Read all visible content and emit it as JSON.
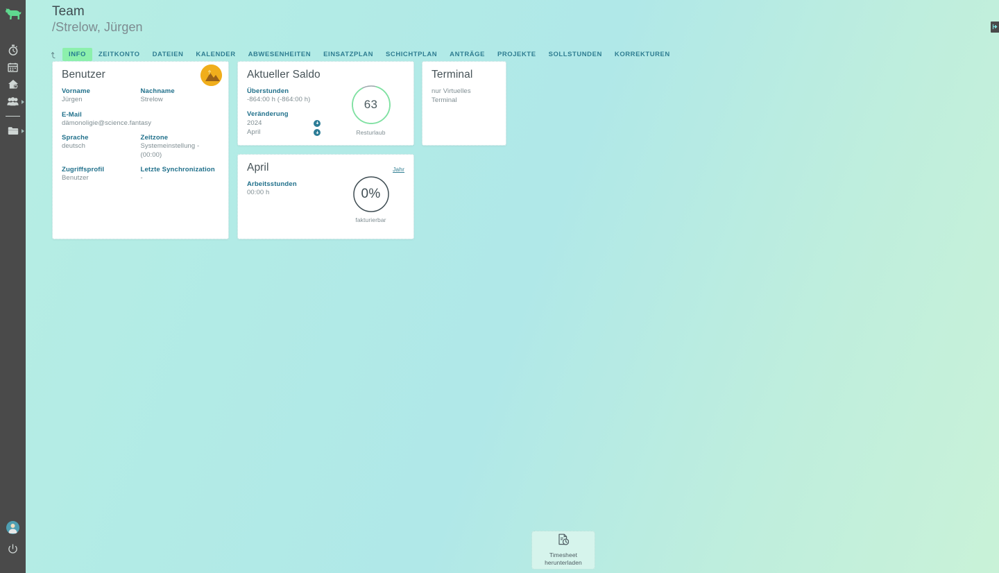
{
  "app": {
    "logo_icon": "dog-logo-icon",
    "accent_green": "#8cf0ac",
    "accent_teal": "#2e7d91",
    "sidebar_bg": "#4a4a4a"
  },
  "sidebar": {
    "items": [
      {
        "name": "stopwatch-icon",
        "label": "Zeiterfassung",
        "has_arrow": false
      },
      {
        "name": "calendar-icon",
        "label": "Kalender",
        "has_arrow": false
      },
      {
        "name": "home-clock-icon",
        "label": "Home",
        "has_arrow": false
      },
      {
        "name": "people-icon",
        "label": "Team",
        "has_arrow": true
      },
      {
        "name": "folder-icon",
        "label": "Projekte",
        "has_arrow": true
      }
    ],
    "bottom": [
      {
        "name": "user-avatar-icon",
        "label": "Benutzerkonto"
      },
      {
        "name": "power-icon",
        "label": "Abmelden"
      }
    ]
  },
  "header": {
    "title": "Team",
    "subtitle": "/Strelow, Jürgen"
  },
  "tabs": {
    "prefix_icon": "history-back-icon",
    "items": [
      {
        "label": "INFO",
        "active": true
      },
      {
        "label": "ZEITKONTO",
        "active": false
      },
      {
        "label": "DATEIEN",
        "active": false
      },
      {
        "label": "KALENDER",
        "active": false
      },
      {
        "label": "ABWESENHEITEN",
        "active": false
      },
      {
        "label": "EINSATZPLAN",
        "active": false
      },
      {
        "label": "SCHICHTPLAN",
        "active": false
      },
      {
        "label": "ANTRÄGE",
        "active": false
      },
      {
        "label": "PROJEKTE",
        "active": false
      },
      {
        "label": "SOLLSTUNDEN",
        "active": false
      },
      {
        "label": "KORREKTUREN",
        "active": false
      }
    ]
  },
  "benutzer_card": {
    "title": "Benutzer",
    "avatar_icon": "user-photo-avatar",
    "fields": {
      "vorname_label": "Vorname",
      "vorname_value": "Jürgen",
      "nachname_label": "Nachname",
      "nachname_value": "Strelow",
      "email_label": "E-Mail",
      "email_value": "dämonoligie@science.fantasy",
      "sprache_label": "Sprache",
      "sprache_value": "deutsch",
      "zeitzone_label": "Zeitzone",
      "zeitzone_value": "Systemeinstellung - (00:00)",
      "zugriffsprofil_label": "Zugriffsprofil",
      "zugriffsprofil_value": "Benutzer",
      "sync_label": "Letzte Synchronization",
      "sync_value": "-"
    }
  },
  "saldo_card": {
    "title": "Aktueller Saldo",
    "ueberstunden_label": "Überstunden",
    "ueberstunden_value": "-864:00 h (-864:00 h)",
    "veraenderung_label": "Veränderung",
    "year_label": "2024",
    "year_icon": "download-circle-icon",
    "month_label": "April",
    "month_icon": "download-circle-icon",
    "ring_value": "63",
    "ring_caption": "Resturlaub",
    "ring_percent": 88,
    "ring_color": "#7fe3a2",
    "ring_track": "#9aa5aa"
  },
  "terminal_card": {
    "title": "Terminal",
    "text": "nur Virtuelles Terminal"
  },
  "april_card": {
    "title": "April",
    "link_label": "Jahr",
    "arbeitsstunden_label": "Arbeitsstunden",
    "arbeitsstunden_value": "00:00 h",
    "ring_value": "0%",
    "ring_caption": "fakturierbar",
    "ring_percent": 0,
    "ring_color": "#3e4c52"
  },
  "download_button": {
    "icon": "document-clock-icon",
    "line1": "Timesheet",
    "line2": "herunterladen"
  },
  "panel_toggle": {
    "icon": "chevron-right-icon"
  }
}
